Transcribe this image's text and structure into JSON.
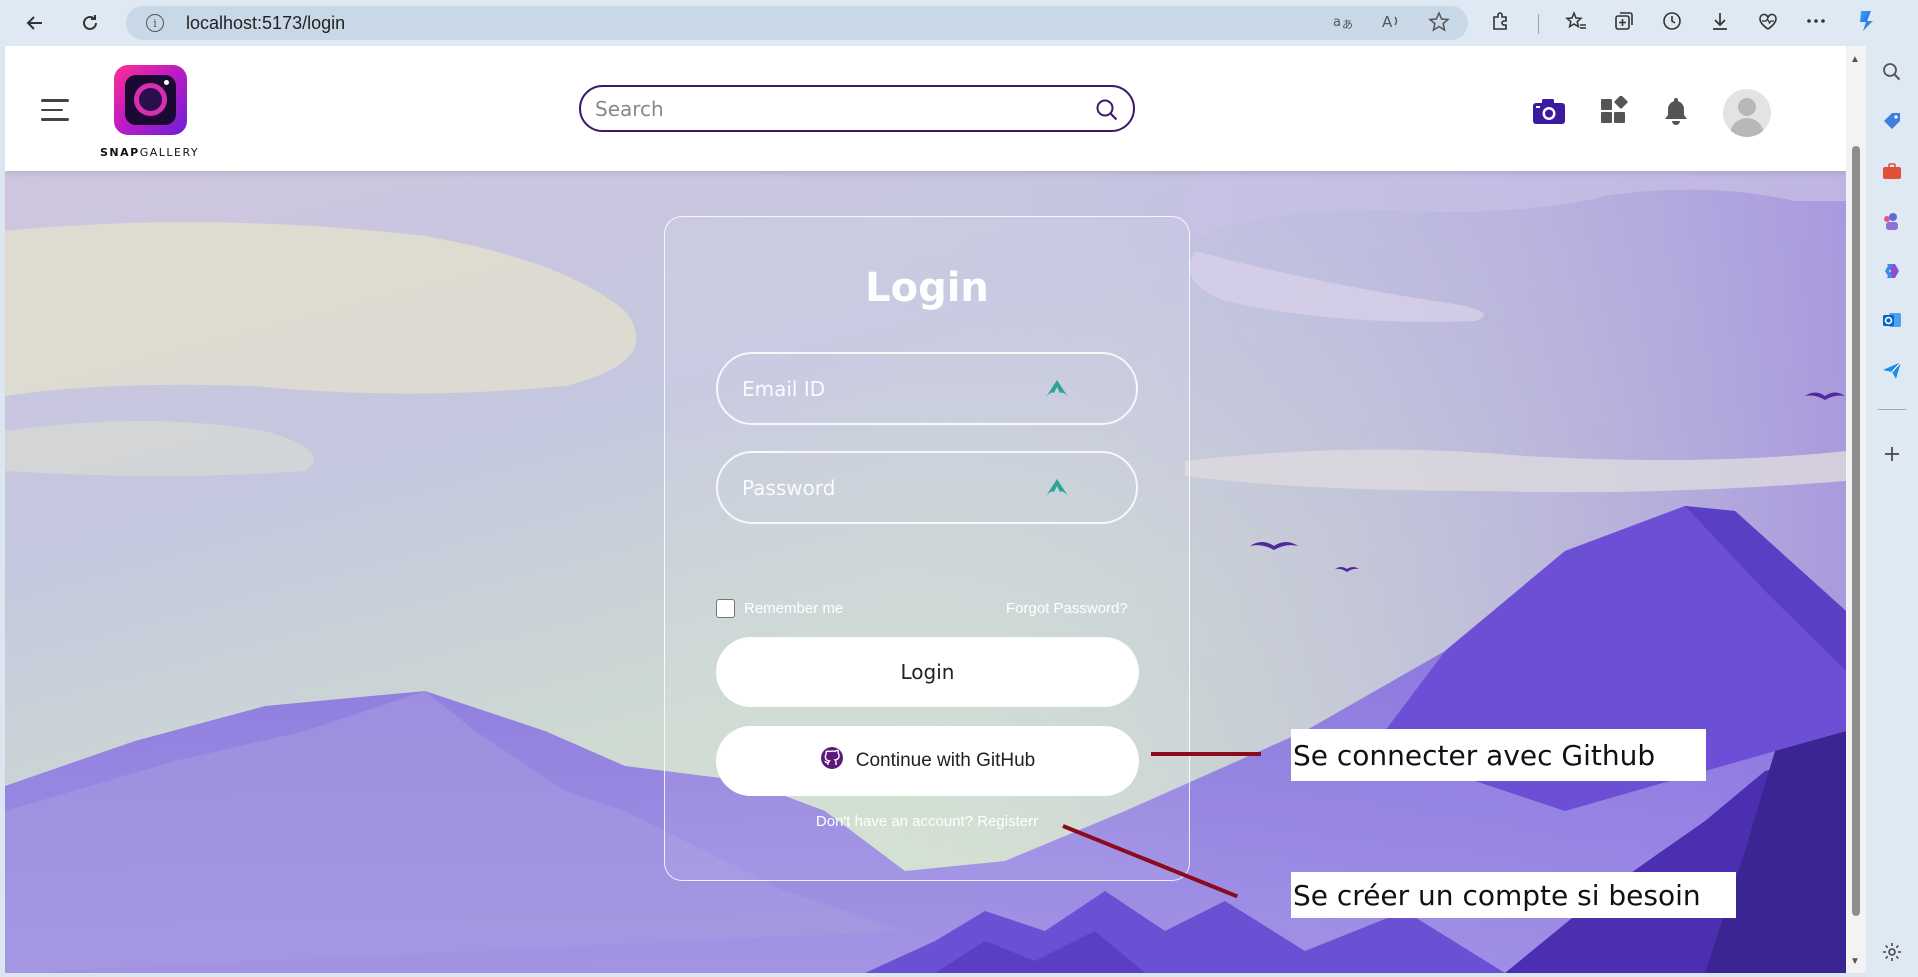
{
  "browser": {
    "url": "localhost:5173/login",
    "colors": {
      "chrome": "#dfe9f3",
      "address_bar": "#c9d8e6"
    }
  },
  "header": {
    "brand_bold": "SNAP",
    "brand_light": "GALLERY",
    "search_placeholder": "Search",
    "icons": [
      "hamburger-menu-icon",
      "camera-icon",
      "apps-icon",
      "bell-icon",
      "avatar"
    ]
  },
  "login": {
    "title": "Login",
    "email_placeholder": "Email ID",
    "password_placeholder": "Password",
    "remember_label": "Remember me",
    "forgot_label": "Forgot Password?",
    "login_button": "Login",
    "github_button": "Continue with GitHub",
    "register_text": "Don't have an account? Registerr"
  },
  "annotations": {
    "github_note": "Se connecter avec Github",
    "register_note": "Se créer un compte si besoin",
    "line_color": "#8b0a1e"
  },
  "theme": {
    "accent": "#3b1a6e",
    "mountain": "#7b5fd8",
    "sky_top": "#c9c0dc"
  }
}
